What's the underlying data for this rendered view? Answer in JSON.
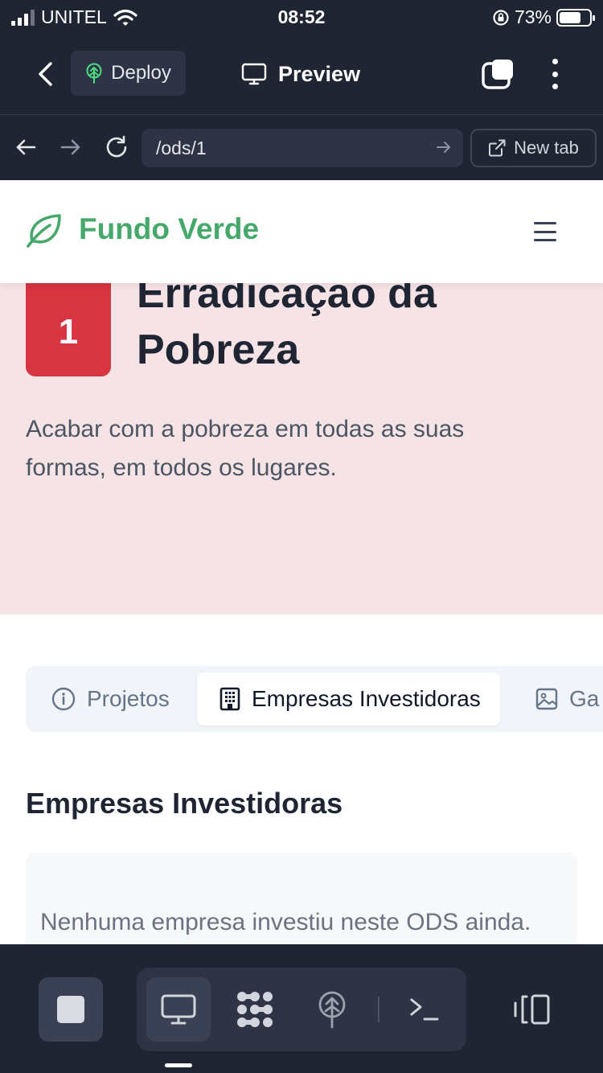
{
  "status_bar": {
    "carrier": "UNITEL",
    "time": "08:52",
    "battery_percent": "73%",
    "battery_level": 0.73
  },
  "app_bar": {
    "deploy_label": "Deploy",
    "preview_title": "Preview"
  },
  "url_bar": {
    "url": "/ods/1",
    "new_tab_label": "New tab"
  },
  "site": {
    "name": "Fundo Verde",
    "brand_color": "#47a86b"
  },
  "ods": {
    "number": "1",
    "title": "Erradicação da Pobreza",
    "description": "Acabar com a pobreza em todas as suas formas, em todos os lugares.",
    "badge_color": "#d63541",
    "hero_background": "#f6e3e6"
  },
  "tabs": [
    {
      "label": "Projetos",
      "icon": "info-icon",
      "active": false
    },
    {
      "label": "Empresas Investidoras",
      "icon": "building-icon",
      "active": true
    },
    {
      "label": "Ga",
      "icon": "image-icon",
      "active": false
    }
  ],
  "section": {
    "title": "Empresas Investidoras",
    "empty_message": "Nenhuma empresa investiu neste ODS ainda."
  },
  "toolbar": {
    "icons": [
      "stop-icon",
      "monitor-icon",
      "apps-grid-icon",
      "deploy-tree-icon",
      "terminal-icon",
      "panel-toggle-icon"
    ]
  }
}
